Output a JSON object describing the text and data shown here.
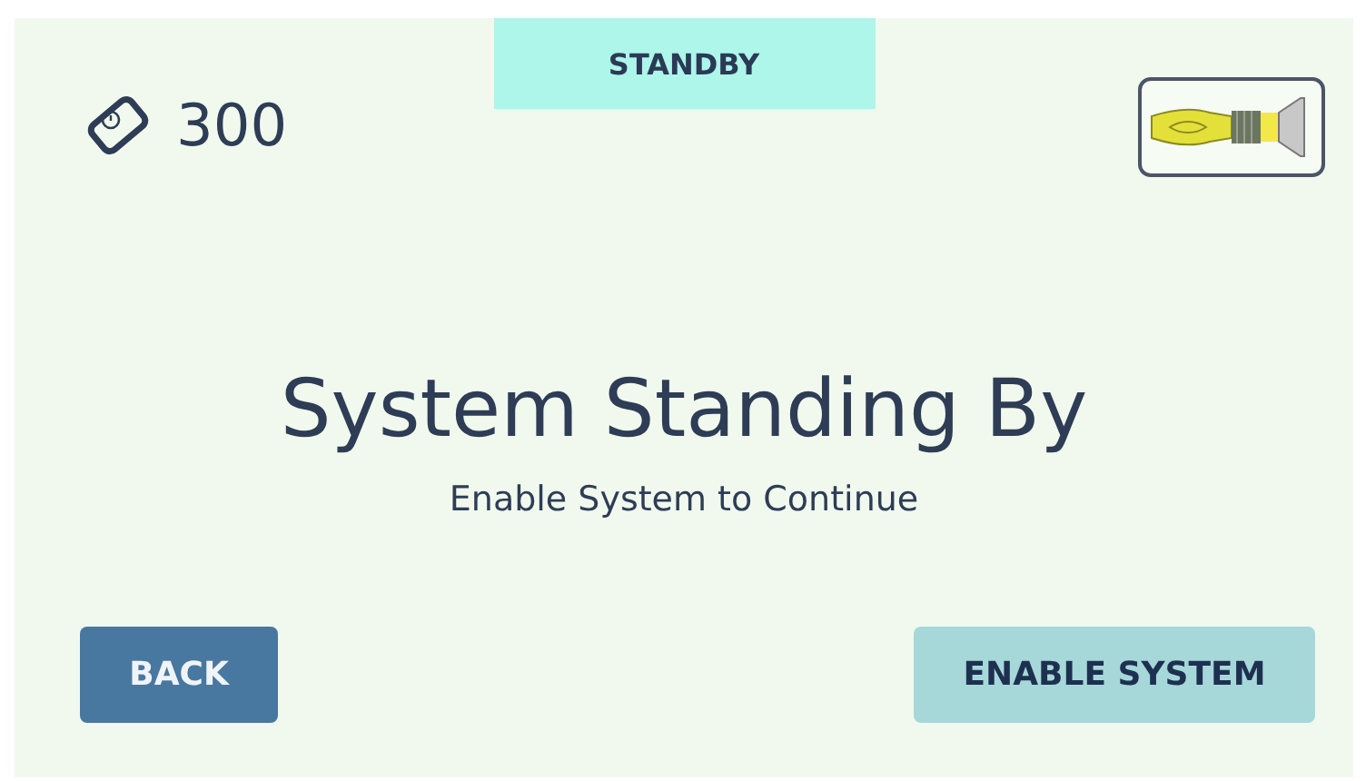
{
  "status_badge": "STANDBY",
  "counter": {
    "value": "300"
  },
  "message": {
    "title": "System Standing By",
    "subtitle": "Enable System to Continue"
  },
  "buttons": [
    {
      "label": "BACK",
      "kind": "primary"
    },
    {
      "label": "ENABLE SYSTEM",
      "kind": "secondary"
    }
  ]
}
